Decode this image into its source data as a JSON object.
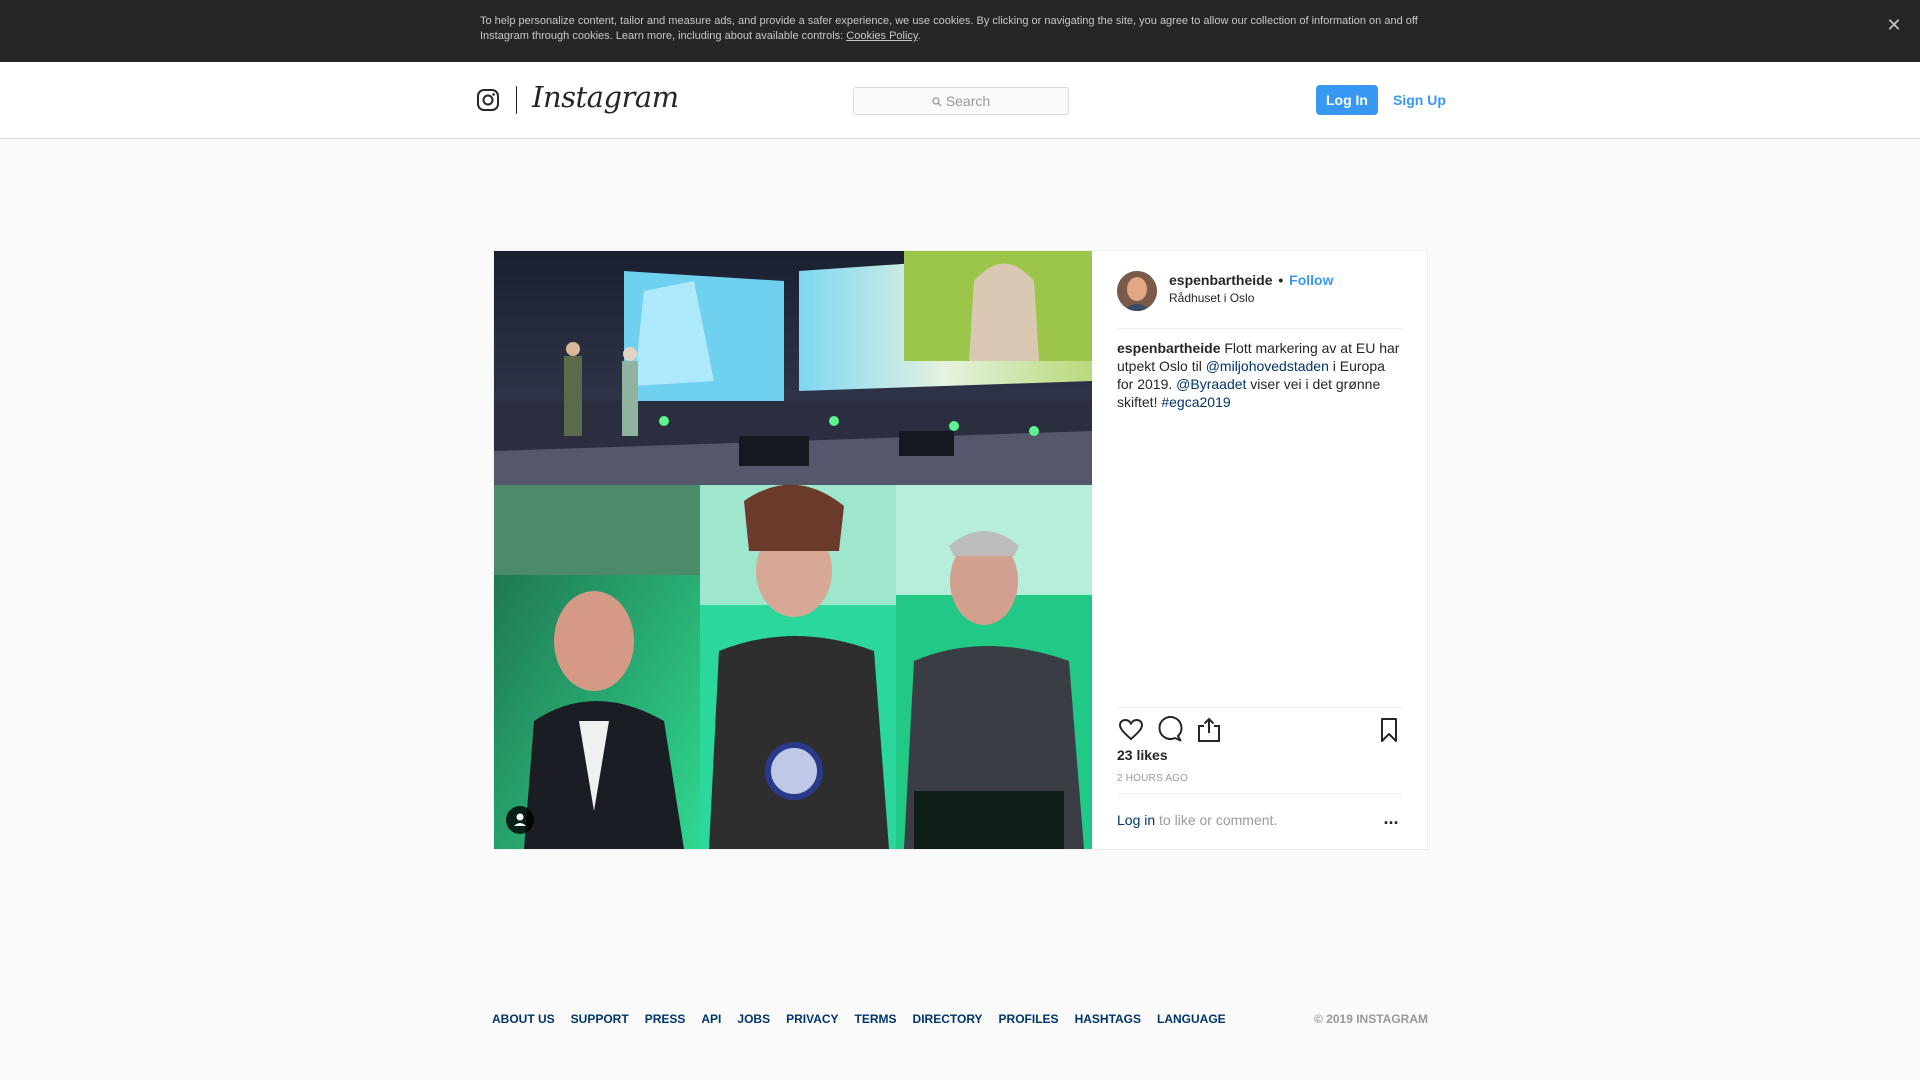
{
  "cookie_banner": {
    "text": "To help personalize content, tailor and measure ads, and provide a safer experience, we use cookies. By clicking or navigating the site, you agree to allow our collection of information on and off Instagram through cookies. Learn more, including about available controls: ",
    "link_label": "Cookies Policy",
    "trailing": ".",
    "close_icon": "close-icon"
  },
  "nav": {
    "wordmark": "Instagram",
    "search_placeholder": "Search",
    "login_label": "Log In",
    "signup_label": "Sign Up"
  },
  "post": {
    "username": "espenbartheide",
    "separator": "•",
    "follow_label": "Follow",
    "location": "Rådhuset i Oslo",
    "caption_user": "espenbartheide",
    "caption_part1": " Flott markering av at EU har utpekt Oslo til ",
    "mention1": "@miljohovedstaden",
    "caption_part2": " i Europa for 2019. ",
    "mention2": "@Byraadet",
    "caption_part3": " viser vei i det grønne skiftet! ",
    "hashtag": "#egca2019",
    "likes": "23 likes",
    "time_ago": "2 HOURS AGO",
    "login_link": "Log in",
    "login_suffix": " to like or comment.",
    "more_label": "..."
  },
  "footer": {
    "links": [
      "ABOUT US",
      "SUPPORT",
      "PRESS",
      "API",
      "JOBS",
      "PRIVACY",
      "TERMS",
      "DIRECTORY",
      "PROFILES",
      "HASHTAGS",
      "LANGUAGE"
    ],
    "copyright": "© 2019 INSTAGRAM"
  },
  "colors": {
    "accent": "#3897f0",
    "link": "#003569",
    "muted": "#999999",
    "banner_bg": "#262626"
  }
}
